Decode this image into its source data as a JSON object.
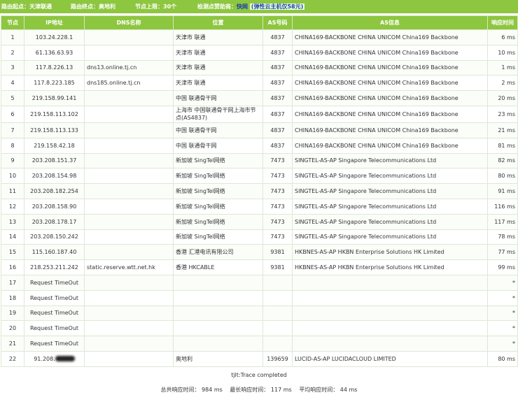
{
  "header": {
    "start_label": "路由起点：天津联通",
    "end_label": "路由终点：奥地利",
    "hops_label": "节点上限：30个",
    "sponsor_prefix": "检测点赞助商：",
    "sponsor_name": "快网",
    "sponsor_promo": "(弹性云主机仅58元)"
  },
  "table": {
    "columns": [
      "节点",
      "IP地址",
      "DNS名称",
      "位置",
      "AS号码",
      "AS信息",
      "响应时间"
    ],
    "rows": [
      {
        "hop": "1",
        "ip": "103.24.228.1",
        "dns": "",
        "loc": "天津市 联通",
        "as": "4837",
        "asinfo": "CHINA169-BACKBONE CHINA UNICOM China169 Backbone",
        "time": "6 ms"
      },
      {
        "hop": "2",
        "ip": "61.136.63.93",
        "dns": "",
        "loc": "天津市 联通",
        "as": "4837",
        "asinfo": "CHINA169-BACKBONE CHINA UNICOM China169 Backbone",
        "time": "10 ms"
      },
      {
        "hop": "3",
        "ip": "117.8.226.13",
        "dns": "dns13.online.tj.cn",
        "loc": "天津市 联通",
        "as": "4837",
        "asinfo": "CHINA169-BACKBONE CHINA UNICOM China169 Backbone",
        "time": "1 ms"
      },
      {
        "hop": "4",
        "ip": "117.8.223.185",
        "dns": "dns185.online.tj.cn",
        "loc": "天津市 联通",
        "as": "4837",
        "asinfo": "CHINA169-BACKBONE CHINA UNICOM China169 Backbone",
        "time": "2 ms"
      },
      {
        "hop": "5",
        "ip": "219.158.99.141",
        "dns": "",
        "loc": "中国 联通骨干网",
        "as": "4837",
        "asinfo": "CHINA169-BACKBONE CHINA UNICOM China169 Backbone",
        "time": "20 ms"
      },
      {
        "hop": "6",
        "ip": "219.158.113.102",
        "dns": "",
        "loc": "上海市 中国联通骨干网上海市节点(AS4837)",
        "as": "4837",
        "asinfo": "CHINA169-BACKBONE CHINA UNICOM China169 Backbone",
        "time": "23 ms"
      },
      {
        "hop": "7",
        "ip": "219.158.113.133",
        "dns": "",
        "loc": "中国 联通骨干网",
        "as": "4837",
        "asinfo": "CHINA169-BACKBONE CHINA UNICOM China169 Backbone",
        "time": "21 ms"
      },
      {
        "hop": "8",
        "ip": "219.158.42.18",
        "dns": "",
        "loc": "中国 联通骨干网",
        "as": "4837",
        "asinfo": "CHINA169-BACKBONE CHINA UNICOM China169 Backbone",
        "time": "81 ms"
      },
      {
        "hop": "9",
        "ip": "203.208.151.37",
        "dns": "",
        "loc": "新加坡 SingTel网络",
        "as": "7473",
        "asinfo": "SINGTEL-AS-AP Singapore Telecommunications Ltd",
        "time": "82 ms"
      },
      {
        "hop": "10",
        "ip": "203.208.154.98",
        "dns": "",
        "loc": "新加坡 SingTel网络",
        "as": "7473",
        "asinfo": "SINGTEL-AS-AP Singapore Telecommunications Ltd",
        "time": "80 ms"
      },
      {
        "hop": "11",
        "ip": "203.208.182.254",
        "dns": "",
        "loc": "新加坡 SingTel网络",
        "as": "7473",
        "asinfo": "SINGTEL-AS-AP Singapore Telecommunications Ltd",
        "time": "91 ms"
      },
      {
        "hop": "12",
        "ip": "203.208.158.90",
        "dns": "",
        "loc": "新加坡 SingTel网络",
        "as": "7473",
        "asinfo": "SINGTEL-AS-AP Singapore Telecommunications Ltd",
        "time": "116 ms"
      },
      {
        "hop": "13",
        "ip": "203.208.178.17",
        "dns": "",
        "loc": "新加坡 SingTel网络",
        "as": "7473",
        "asinfo": "SINGTEL-AS-AP Singapore Telecommunications Ltd",
        "time": "117 ms"
      },
      {
        "hop": "14",
        "ip": "203.208.150.242",
        "dns": "",
        "loc": "新加坡 SingTel网络",
        "as": "7473",
        "asinfo": "SINGTEL-AS-AP Singapore Telecommunications Ltd",
        "time": "78 ms"
      },
      {
        "hop": "15",
        "ip": "115.160.187.40",
        "dns": "",
        "loc": "香港 汇港电讯有限公司",
        "as": "9381",
        "asinfo": "HKBNES-AS-AP HKBN Enterprise Solutions HK Limited",
        "time": "77 ms"
      },
      {
        "hop": "16",
        "ip": "218.253.211.242",
        "dns": "static.reserve.wtt.net.hk",
        "loc": "香港 HKCABLE",
        "as": "9381",
        "asinfo": "HKBNES-AS-AP HKBN Enterprise Solutions HK Limited",
        "time": "99 ms"
      },
      {
        "hop": "17",
        "ip": "Request TimeOut",
        "dns": "",
        "loc": "",
        "as": "",
        "asinfo": "",
        "time": "*"
      },
      {
        "hop": "18",
        "ip": "Request TimeOut",
        "dns": "",
        "loc": "",
        "as": "",
        "asinfo": "",
        "time": "*"
      },
      {
        "hop": "19",
        "ip": "Request TimeOut",
        "dns": "",
        "loc": "",
        "as": "",
        "asinfo": "",
        "time": "*"
      },
      {
        "hop": "20",
        "ip": "Request TimeOut",
        "dns": "",
        "loc": "",
        "as": "",
        "asinfo": "",
        "time": "*"
      },
      {
        "hop": "21",
        "ip": "Request TimeOut",
        "dns": "",
        "loc": "",
        "as": "",
        "asinfo": "",
        "time": "*"
      },
      {
        "hop": "22",
        "ip": "91.208.",
        "dns": "",
        "loc": "奥地利",
        "as": "139659",
        "asinfo": "LUCID-AS-AP LUCIDACLOUD LIMITED",
        "time": "80 ms"
      }
    ]
  },
  "footer": {
    "status": "tjlt:Trace completed",
    "total": "总共响应时间： 984 ms",
    "longest": "最长响应时间： 117 ms",
    "average": "平均响应时间： 44 ms"
  }
}
